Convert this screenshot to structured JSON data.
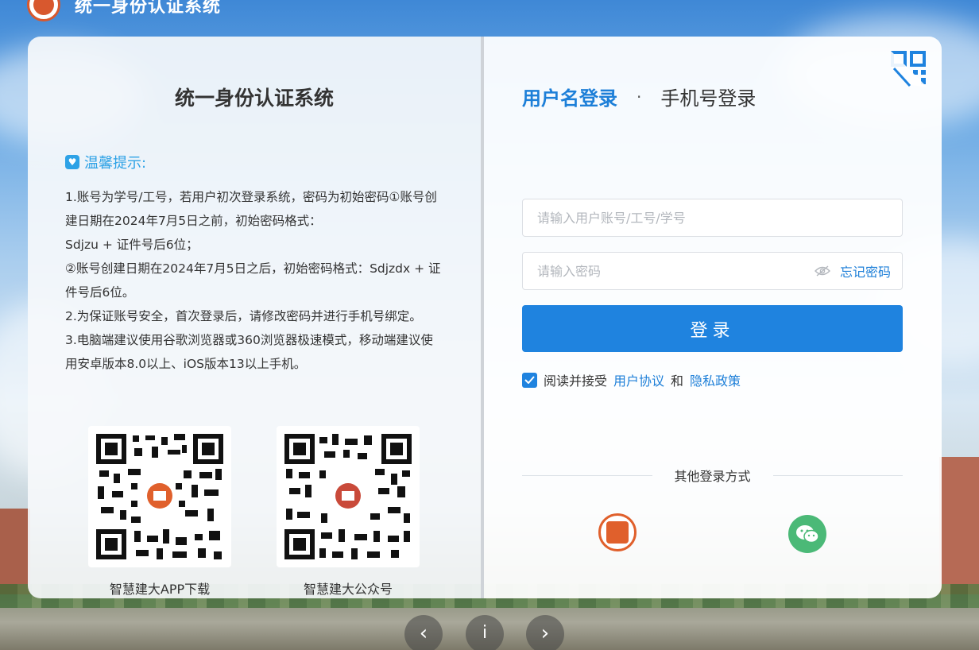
{
  "header": {
    "title": "统一身份认证系统"
  },
  "left": {
    "title": "统一身份认证系统",
    "tip_heading": "温馨提示:",
    "tips": [
      "1.账号为学号/工号，若用户初次登录系统，密码为初始密码①账号创建日期在2024年7月5日之前，初始密码格式：",
      "Sdjzu + 证件号后6位；",
      "②账号创建日期在2024年7月5日之后，初始密码格式：Sdjzdx + 证件号后6位。",
      "2.为保证账号安全，首次登录后，请修改密码并进行手机号绑定。",
      "3.电脑端建议使用谷歌浏览器或360浏览器极速模式，移动端建议使用安卓版本8.0以上、iOS版本13以上手机。"
    ],
    "qr_app_caption": "智慧建大APP下载",
    "qr_wechat_caption": "智慧建大公众号"
  },
  "login": {
    "tab_username": "用户名登录",
    "tab_separator": "·",
    "tab_phone": "手机号登录",
    "username_placeholder": "请输入用户账号/工号/学号",
    "password_placeholder": "请输入密码",
    "forgot_label": "忘记密码",
    "submit_label": "登录",
    "agree_text": "阅读并接受",
    "agreement_link": "用户协议",
    "and_text": "和",
    "privacy_link": "隐私政策",
    "agree_checked": true,
    "other_methods_label": "其他登录方式"
  },
  "carousel": {
    "prev": "‹",
    "info": "i",
    "next": "›"
  },
  "colors": {
    "accent": "#1f83df",
    "tip": "#2ea2e6",
    "wechat": "#4bb977",
    "logo": "#e0602c"
  }
}
